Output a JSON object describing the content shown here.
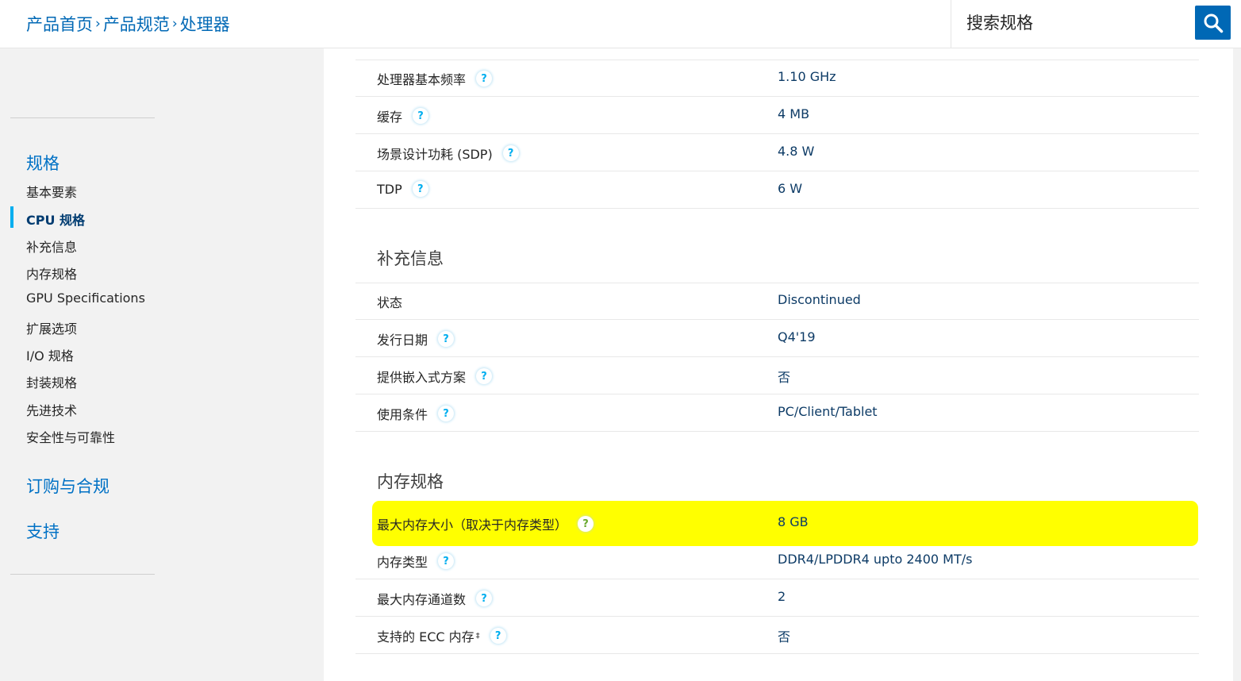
{
  "header": {
    "breadcrumb": [
      "产品首页",
      "产品规范",
      "处理器"
    ],
    "breadcrumb_separator": "›",
    "search_placeholder": "搜索规格"
  },
  "sidebar": {
    "specs_heading": "规格",
    "items": [
      {
        "label": "基本要素"
      },
      {
        "label": "CPU 规格",
        "active": true
      },
      {
        "label": "补充信息"
      },
      {
        "label": "内存规格"
      },
      {
        "label": "GPU Specifications"
      },
      {
        "label": "扩展选项"
      },
      {
        "label": "I/O 规格"
      },
      {
        "label": "封装规格"
      },
      {
        "label": "先进技术"
      },
      {
        "label": "安全性与可靠性"
      }
    ],
    "ordering_heading": "订购与合规",
    "support_heading": "支持"
  },
  "cpu_specs": {
    "rows": [
      {
        "label": "处理器基本频率",
        "value": "1.10 GHz"
      },
      {
        "label": "缓存",
        "value": "4 MB"
      },
      {
        "label": "场景设计功耗 (SDP)",
        "value": "4.8 W"
      },
      {
        "label": "TDP",
        "value": "6 W"
      }
    ]
  },
  "supplemental": {
    "title": "补充信息",
    "rows": [
      {
        "label": "状态",
        "value": "Discontinued"
      },
      {
        "label": "发行日期",
        "value": "Q4'19"
      },
      {
        "label": "提供嵌入式方案",
        "value": "否"
      },
      {
        "label": "使用条件",
        "value": "PC/Client/Tablet"
      }
    ]
  },
  "memory": {
    "title": "内存规格",
    "rows": [
      {
        "label": "最大内存大小（取决于内存类型）",
        "value": "8 GB",
        "highlighted": true
      },
      {
        "label": "内存类型",
        "value": "DDR4/LPDDR4 upto 2400 MT/s"
      },
      {
        "label": "最大内存通道数",
        "value": "2"
      },
      {
        "label": "支持的 ECC 内存",
        "label_suffix": "‡",
        "value": "否"
      }
    ]
  },
  "help_glyph": "?",
  "colors": {
    "link_blue": "#0068b5",
    "accent_cyan": "#00aeef",
    "highlight_yellow": "#ffff00",
    "sidebar_bg": "#f2f2f2"
  },
  "icons": {
    "search_button": "search-icon",
    "help": "help-circle-icon"
  }
}
